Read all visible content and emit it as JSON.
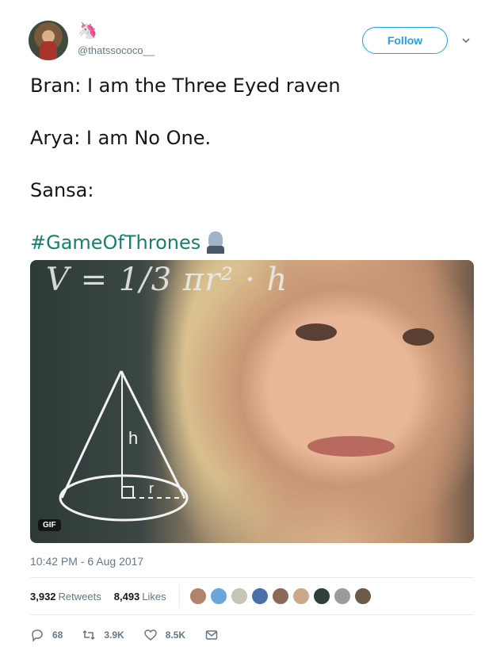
{
  "user": {
    "name_emoji": "🦄",
    "handle": "@thatssococo__"
  },
  "follow_label": "Follow",
  "tweet": {
    "lines": [
      "Bran: I am the Three Eyed raven",
      "Arya: I am No One.",
      "Sansa:"
    ],
    "hashtag": "#GameOfThrones"
  },
  "media": {
    "formula": "V = 1/3 πr² · h",
    "cone_label": "h",
    "radius_label": "r",
    "badge": "GIF"
  },
  "timestamp": "10:42 PM - 6 Aug 2017",
  "stats": {
    "retweets_count": "3,932",
    "retweets_label": "Retweets",
    "likes_count": "8,493",
    "likes_label": "Likes"
  },
  "likers": [
    "#b0846a",
    "#6aa6d8",
    "#c7c3b8",
    "#4a6fa8",
    "#8a6a5a",
    "#c9a98a",
    "#2f3f3a",
    "#9a9a9a",
    "#6b5a4a"
  ],
  "actions": {
    "replies": "68",
    "retweets": "3.9K",
    "likes": "8.5K"
  },
  "colors": {
    "accent": "#1da1f2",
    "hashtag": "#17806b",
    "muted": "#657786"
  }
}
